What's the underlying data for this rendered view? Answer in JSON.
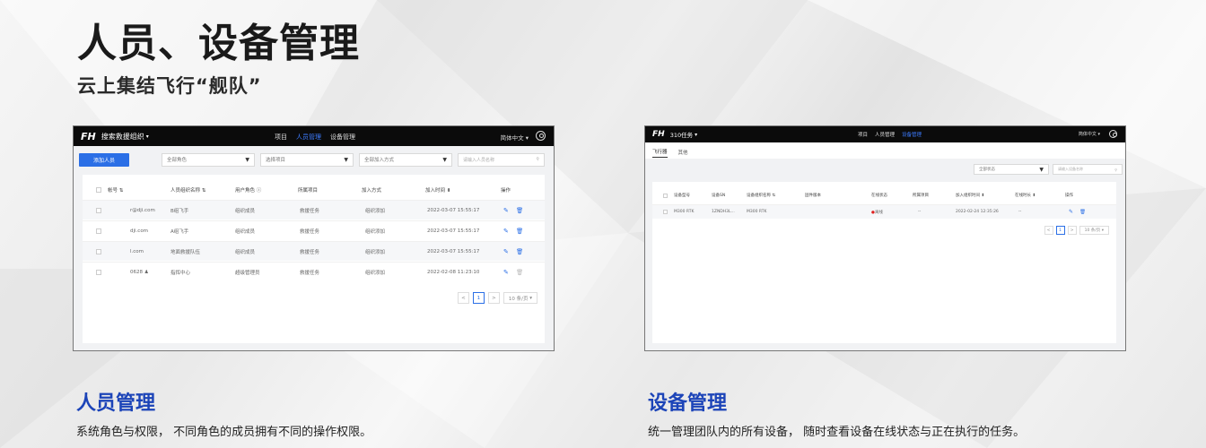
{
  "header": {
    "title": "人员、设备管理",
    "subtitle": "云上集结飞行“舰队”"
  },
  "personnel_panel": {
    "logo": "FH",
    "org": "搜索救援组织",
    "nav": [
      "项目",
      "人员管理",
      "设备管理"
    ],
    "active_nav": 1,
    "lang": "简体中文",
    "add_button": "添加人员",
    "filters": {
      "role": "全部角色",
      "project": "选择项目",
      "join_method": "全部加入方式",
      "search_placeholder": "请输入人员名称"
    },
    "columns": [
      "帐号 ⇅",
      "人员组织名称 ⇅",
      "用户角色 ⓘ",
      "所属项目",
      "加入方式",
      "加入时间 ⬍",
      "操作"
    ],
    "rows": [
      {
        "account": "r@dji.com",
        "name": "B组飞手",
        "role": "组织成员",
        "project": "救援任务",
        "join": "组织添加",
        "time": "2022-03-07 15:55:17"
      },
      {
        "account": "dji.com",
        "name": "A组飞手",
        "role": "组织成员",
        "project": "救援任务",
        "join": "组织添加",
        "time": "2022-03-07 15:55:17"
      },
      {
        "account": "l.com",
        "name": "地面救援队伍",
        "role": "组织成员",
        "project": "救援任务",
        "join": "组织添加",
        "time": "2022-03-07 15:55:17"
      },
      {
        "account": "0628 ♟",
        "name": "指挥中心",
        "role": "超级管理员",
        "project": "救援任务",
        "join": "组织添加",
        "time": "2022-02-08 11:23:10"
      }
    ],
    "pager": {
      "prev": "<",
      "page": "1",
      "next": ">",
      "size": "10 条/页"
    }
  },
  "device_panel": {
    "logo": "FH",
    "org": "310任务",
    "nav": [
      "项目",
      "人员管理",
      "设备管理"
    ],
    "active_nav": 2,
    "lang": "简体中文",
    "tabs": [
      "飞行器",
      "其他"
    ],
    "active_tab": 0,
    "filters": {
      "status": "全部状态",
      "search_placeholder": "请输入设备名称"
    },
    "columns": [
      "设备型号",
      "设备SN",
      "设备组织名称 ⇅",
      "固件版本",
      "在线状态",
      "所属项目",
      "加入组织时间 ⬍",
      "在线时长 ⬍",
      "操作"
    ],
    "rows": [
      {
        "model": "M300 RTK",
        "sn": "1ZNDH3L...",
        "name": "M300 RTK",
        "fw": "",
        "status": "离线",
        "project": "--",
        "joined": "2022-02-24 12:35:26",
        "duration": "--"
      }
    ],
    "pager": {
      "prev": "<",
      "page": "1",
      "next": ">",
      "size": "10 条/页"
    }
  },
  "sections": [
    {
      "title": "人员管理",
      "desc": "系统角色与权限，  不同角色的成员拥有不同的操作权限。"
    },
    {
      "title": "设备管理",
      "desc": "统一管理团队内的所有设备，  随时查看设备在线状态与正在执行的任务。"
    }
  ],
  "colors": {
    "accent": "#2b6fe6",
    "section_title": "#1c44b8",
    "appbar": "#0b0b0b",
    "offline_dot": "#e02020"
  }
}
